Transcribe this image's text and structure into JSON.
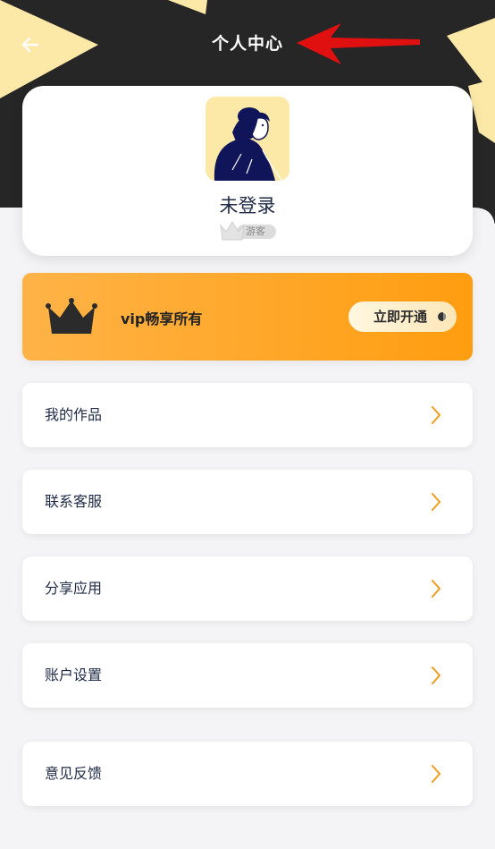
{
  "header": {
    "title": "个人中心",
    "back_icon": "arrow-left-icon"
  },
  "profile": {
    "user_name": "未登录",
    "badge_label": "游客",
    "avatar_icon": "woman-avatar-illustration"
  },
  "vip": {
    "text": "vip畅享所有",
    "button_label": "立即开通",
    "crown_icon": "crown-icon"
  },
  "menu": {
    "items": [
      {
        "label": "我的作品"
      },
      {
        "label": "联系客服"
      },
      {
        "label": "分享应用"
      },
      {
        "label": "账户设置"
      },
      {
        "label": "意见反馈"
      }
    ],
    "arrow_icon": "chevron-right-icon"
  },
  "colors": {
    "header_bg": "#262626",
    "accent_yellow": "#fde9a7",
    "vip_orange": "#ff9d10",
    "chevron_orange": "#f29a1b",
    "text_dark": "#1f2a44",
    "annotation_red": "#e01010"
  }
}
